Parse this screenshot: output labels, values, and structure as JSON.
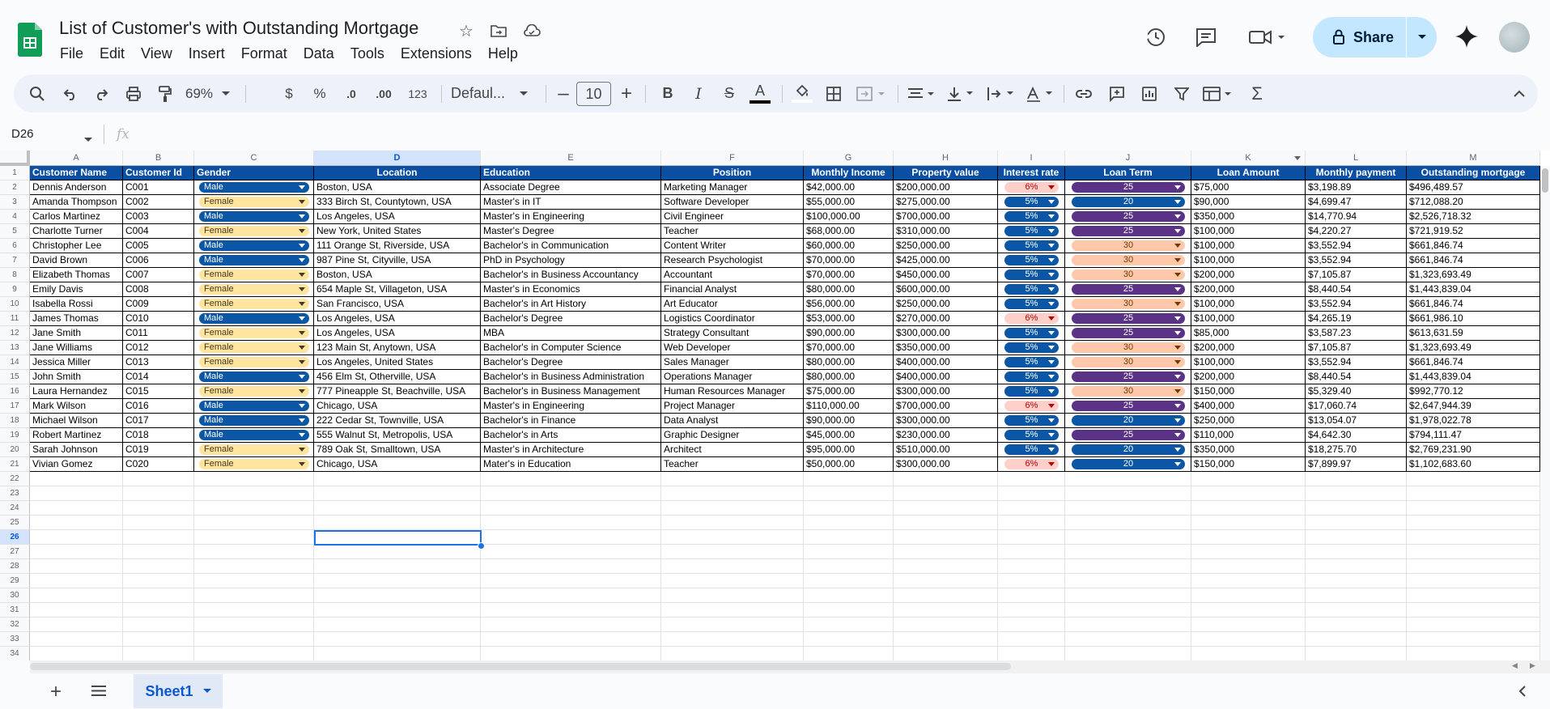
{
  "doc_title": "List of Customer's with Outstanding Mortgage",
  "menu": [
    "File",
    "Edit",
    "View",
    "Insert",
    "Format",
    "Data",
    "Tools",
    "Extensions",
    "Help"
  ],
  "share_label": "Share",
  "toolbar": {
    "zoom": "69%",
    "currency": "$",
    "percent": "%",
    "dec_less": ".0",
    "dec_more": ".00",
    "number_format": "123",
    "font": "Defaul...",
    "font_size": "10",
    "bold": "B",
    "italic": "I",
    "strike": "S",
    "text_color": "A"
  },
  "name_box": "D26",
  "fx_label": "fx",
  "columns": [
    "A",
    "B",
    "C",
    "D",
    "E",
    "F",
    "G",
    "H",
    "I",
    "J",
    "K",
    "L",
    "M"
  ],
  "headers": [
    "Customer Name",
    "Customer Id",
    "Gender",
    "Location",
    "Education",
    "Position",
    "Monthly Income",
    "Property value",
    "Interest rate",
    "Loan Term",
    "Loan Amount",
    "Monthly payment",
    "Outstanding mortgage"
  ],
  "rows": [
    [
      "Dennis Anderson",
      "C001",
      "Male",
      "Boston, USA",
      "Associate Degree",
      "Marketing Manager",
      "$42,000.00",
      "$200,000.00",
      "6%",
      "25",
      "$75,000",
      "$3,198.89",
      "$496,489.57"
    ],
    [
      "Amanda Thompson",
      "C002",
      "Female",
      "333 Birch St, Countytown, USA",
      "Master's in IT",
      "Software Developer",
      "$55,000.00",
      "$275,000.00",
      "5%",
      "20",
      "$90,000",
      "$4,699.47",
      "$712,088.20"
    ],
    [
      "Carlos Martinez",
      "C003",
      "Male",
      "Los Angeles, USA",
      "Master's in Engineering",
      "Civil Engineer",
      "$100,000.00",
      "$700,000.00",
      "5%",
      "25",
      "$350,000",
      "$14,770.94",
      "$2,526,718.32"
    ],
    [
      "Charlotte Turner",
      "C004",
      "Female",
      "New York, United States",
      "Master's Degree",
      "Teacher",
      "$68,000.00",
      "$310,000.00",
      "5%",
      "25",
      "$100,000",
      "$4,220.27",
      "$721,919.52"
    ],
    [
      "Christopher Lee",
      "C005",
      "Male",
      "111 Orange St, Riverside, USA",
      "Bachelor's in Communication",
      "Content Writer",
      "$60,000.00",
      "$250,000.00",
      "5%",
      "30",
      "$100,000",
      "$3,552.94",
      "$661,846.74"
    ],
    [
      "David Brown",
      "C006",
      "Male",
      "987 Pine St, Cityville, USA",
      "PhD in Psychology",
      "Research Psychologist",
      "$70,000.00",
      "$425,000.00",
      "5%",
      "30",
      "$100,000",
      "$3,552.94",
      "$661,846.74"
    ],
    [
      "Elizabeth Thomas",
      "C007",
      "Female",
      "Boston, USA",
      "Bachelor's in Business Accountancy",
      "Accountant",
      "$70,000.00",
      "$450,000.00",
      "5%",
      "30",
      "$200,000",
      "$7,105.87",
      "$1,323,693.49"
    ],
    [
      "Emily Davis",
      "C008",
      "Female",
      "654 Maple St, Villageton, USA",
      "Master's in Economics",
      "Financial Analyst",
      "$80,000.00",
      "$600,000.00",
      "5%",
      "25",
      "$200,000",
      "$8,440.54",
      "$1,443,839.04"
    ],
    [
      "Isabella Rossi",
      "C009",
      "Female",
      "San Francisco, USA",
      "Bachelor's in Art History",
      "Art Educator",
      "$56,000.00",
      "$250,000.00",
      "5%",
      "30",
      "$100,000",
      "$3,552.94",
      "$661,846.74"
    ],
    [
      "James Thomas",
      "C010",
      "Male",
      "Los Angeles, USA",
      "Bachelor's Degree",
      "Logistics Coordinator",
      "$53,000.00",
      "$270,000.00",
      "6%",
      "25",
      "$100,000",
      "$4,265.19",
      "$661,986.10"
    ],
    [
      "Jane Smith",
      "C011",
      "Female",
      "Los Angeles, USA",
      "MBA",
      "Strategy Consultant",
      "$90,000.00",
      "$300,000.00",
      "5%",
      "25",
      "$85,000",
      "$3,587.23",
      "$613,631.59"
    ],
    [
      "Jane Williams",
      "C012",
      "Female",
      "123 Main St, Anytown, USA",
      "Bachelor's in Computer Science",
      "Web Developer",
      "$70,000.00",
      "$350,000.00",
      "5%",
      "30",
      "$200,000",
      "$7,105.87",
      "$1,323,693.49"
    ],
    [
      "Jessica Miller",
      "C013",
      "Female",
      "Los Angeles, United States",
      "Bachelor's Degree",
      "Sales Manager",
      "$80,000.00",
      "$400,000.00",
      "5%",
      "30",
      "$100,000",
      "$3,552.94",
      "$661,846.74"
    ],
    [
      "John Smith",
      "C014",
      "Male",
      "456 Elm St, Otherville, USA",
      "Bachelor's in Business Administration",
      "Operations Manager",
      "$80,000.00",
      "$400,000.00",
      "5%",
      "25",
      "$200,000",
      "$8,440.54",
      "$1,443,839.04"
    ],
    [
      "Laura Hernandez",
      "C015",
      "Female",
      "777 Pineapple St, Beachville, USA",
      "Bachelor's in Business Management",
      "Human Resources Manager",
      "$75,000.00",
      "$300,000.00",
      "5%",
      "30",
      "$150,000",
      "$5,329.40",
      "$992,770.12"
    ],
    [
      "Mark Wilson",
      "C016",
      "Male",
      "Chicago, USA",
      "Master's in Engineering",
      "Project Manager",
      "$110,000.00",
      "$700,000.00",
      "6%",
      "25",
      "$400,000",
      "$17,060.74",
      "$2,647,944.39"
    ],
    [
      "Michael Wilson",
      "C017",
      "Male",
      "222 Cedar St, Townville, USA",
      "Bachelor's in Finance",
      "Data Analyst",
      "$90,000.00",
      "$300,000.00",
      "5%",
      "20",
      "$250,000",
      "$13,054.07",
      "$1,978,022.78"
    ],
    [
      "Robert Martinez",
      "C018",
      "Male",
      "555 Walnut St, Metropolis, USA",
      "Bachelor's in Arts",
      "Graphic Designer",
      "$45,000.00",
      "$230,000.00",
      "5%",
      "25",
      "$110,000",
      "$4,642.30",
      "$794,111.47"
    ],
    [
      "Sarah Johnson",
      "C019",
      "Female",
      "789 Oak St, Smalltown, USA",
      "Master's in Architecture",
      "Architect",
      "$95,000.00",
      "$510,000.00",
      "5%",
      "20",
      "$350,000",
      "$18,275.70",
      "$2,769,231.90"
    ],
    [
      "Vivian Gomez",
      "C020",
      "Female",
      "Chicago, USA",
      "Mater's in Education",
      "Teacher",
      "$50,000.00",
      "$300,000.00",
      "6%",
      "20",
      "$150,000",
      "$7,899.97",
      "$1,102,683.60"
    ]
  ],
  "row_numbers": [
    "1",
    "2",
    "3",
    "4",
    "5",
    "6",
    "7",
    "8",
    "9",
    "10",
    "11",
    "12",
    "13",
    "14",
    "15",
    "16",
    "17",
    "18",
    "19",
    "20",
    "21",
    "22",
    "23",
    "24",
    "25",
    "26",
    "27",
    "28",
    "29",
    "30",
    "31",
    "32",
    "33",
    "34"
  ],
  "chip_colors": {
    "Male": {
      "bg": "#0b57a6",
      "fg": "#ffffff"
    },
    "Female": {
      "bg": "#ffe5a0",
      "fg": "#473821"
    },
    "5%": {
      "bg": "#0b57a6",
      "fg": "#ffffff"
    },
    "6%": {
      "bg": "#ffcfc9",
      "fg": "#b10202"
    },
    "20": {
      "bg": "#0b57a6",
      "fg": "#ffffff"
    },
    "25": {
      "bg": "#5a3286",
      "fg": "#ffffff"
    },
    "30": {
      "bg": "#ffc8aa",
      "fg": "#753800"
    }
  },
  "header_color": "#0b4fa3",
  "sheet_tab": "Sheet1"
}
